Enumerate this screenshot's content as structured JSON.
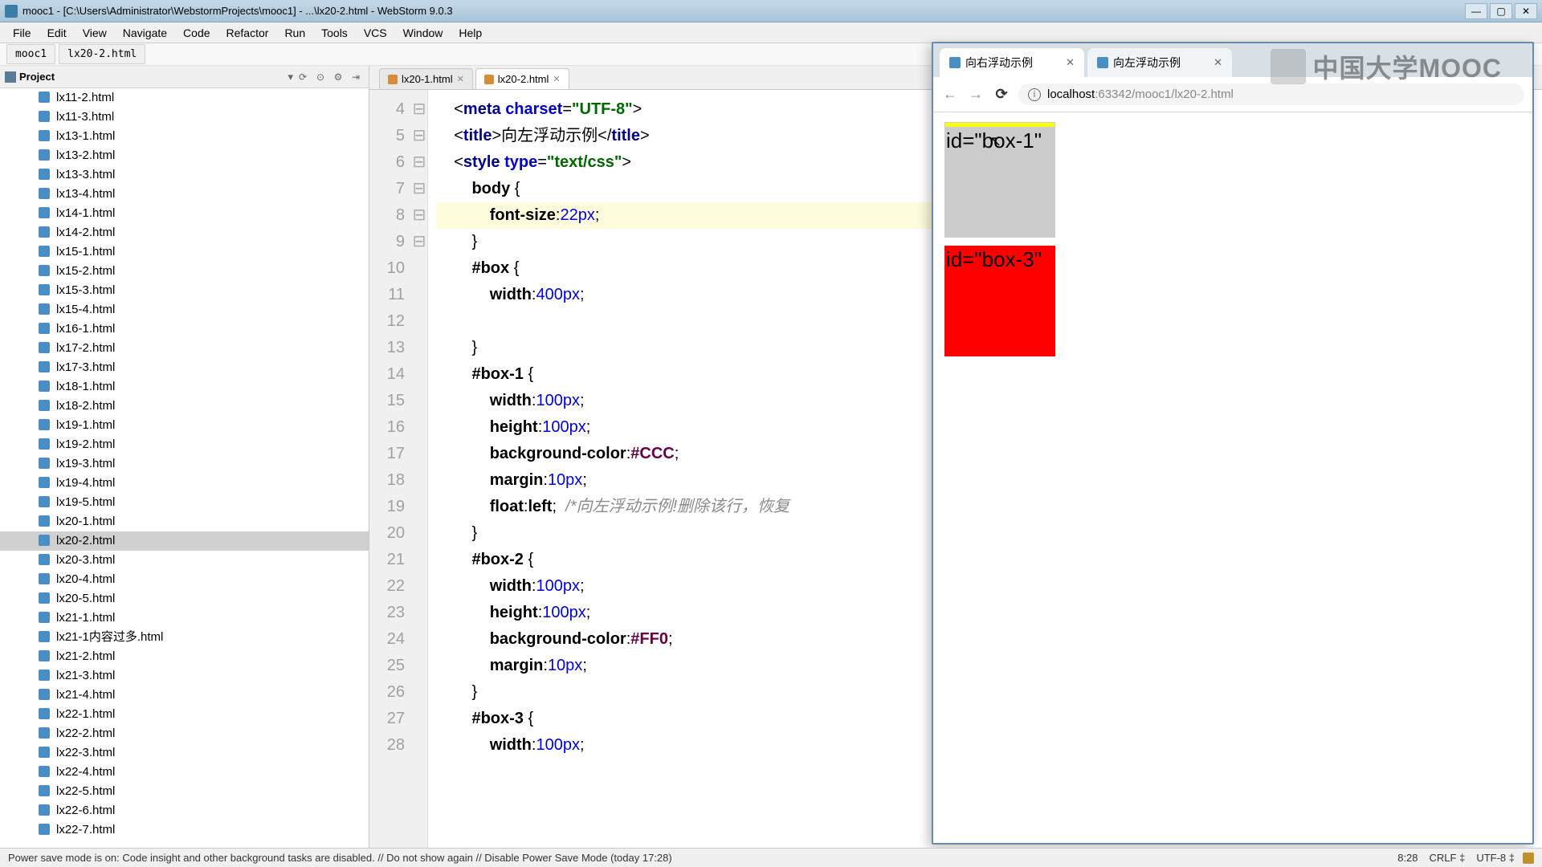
{
  "window": {
    "title": "mooc1 - [C:\\Users\\Administrator\\WebstormProjects\\mooc1] - ...\\lx20-2.html - WebStorm 9.0.3",
    "minimize": "—",
    "maximize": "▢",
    "close": "✕"
  },
  "menu": [
    "File",
    "Edit",
    "View",
    "Navigate",
    "Code",
    "Refactor",
    "Run",
    "Tools",
    "VCS",
    "Window",
    "Help"
  ],
  "breadcrumb": {
    "root": "mooc1",
    "file": "lx20-2.html"
  },
  "project": {
    "label": "Project",
    "collapse_icon": "▾",
    "tool_icons": {
      "sync": "⟳",
      "locate": "⊙",
      "gear": "⚙",
      "hide": "⇥"
    },
    "items": [
      "lx11-2.html",
      "lx11-3.html",
      "lx13-1.html",
      "lx13-2.html",
      "lx13-3.html",
      "lx13-4.html",
      "lx14-1.html",
      "lx14-2.html",
      "lx15-1.html",
      "lx15-2.html",
      "lx15-3.html",
      "lx15-4.html",
      "lx16-1.html",
      "lx17-2.html",
      "lx17-3.html",
      "lx18-1.html",
      "lx18-2.html",
      "lx19-1.html",
      "lx19-2.html",
      "lx19-3.html",
      "lx19-4.html",
      "lx19-5.html",
      "lx20-1.html",
      "lx20-2.html",
      "lx20-3.html",
      "lx20-4.html",
      "lx20-5.html",
      "lx21-1.html",
      "lx21-1内容过多.html",
      "lx21-2.html",
      "lx21-3.html",
      "lx21-4.html",
      "lx22-1.html",
      "lx22-2.html",
      "lx22-3.html",
      "lx22-4.html",
      "lx22-5.html",
      "lx22-6.html",
      "lx22-7.html"
    ],
    "selected_index": 23
  },
  "editor": {
    "tabs": [
      {
        "name": "lx20-1.html",
        "active": false
      },
      {
        "name": "lx20-2.html",
        "active": true
      }
    ],
    "first_line": 4,
    "lines": [
      {
        "no": 4,
        "fold": "",
        "html": "    <span class='punct'>&lt;</span><span class='kw'>meta</span> <span class='attr'>charset</span><span class='punct'>=</span><span class='str'>\"UTF-8\"</span><span class='punct'>&gt;</span>"
      },
      {
        "no": 5,
        "fold": "",
        "html": "    <span class='punct'>&lt;</span><span class='kw'>title</span><span class='punct'>&gt;</span>向左浮动示例<span class='punct'>&lt;/</span><span class='kw'>title</span><span class='punct'>&gt;</span>"
      },
      {
        "no": 6,
        "fold": "⊟",
        "html": "    <span class='punct'>&lt;</span><span class='kw'>style</span> <span class='attr'>type</span><span class='punct'>=</span><span class='str'>\"text/css\"</span><span class='punct'>&gt;</span>"
      },
      {
        "no": 7,
        "fold": "⊟",
        "html": "        <span class='sel'>body</span> <span class='punct'>{</span>"
      },
      {
        "no": 8,
        "fold": "",
        "hl": true,
        "html": "            <span class='prop'>font-size</span><span class='punct'>:</span><span class='num'>22px</span><span class='punct'>;</span>"
      },
      {
        "no": 9,
        "fold": "⊟",
        "html": "        <span class='punct'>}</span>"
      },
      {
        "no": 10,
        "fold": "",
        "html": "        <span class='sel'>#box</span> <span class='punct'>{</span>"
      },
      {
        "no": 11,
        "fold": "",
        "html": "            <span class='prop'>width</span><span class='punct'>:</span><span class='num'>400px</span><span class='punct'>;</span>"
      },
      {
        "no": 12,
        "fold": "",
        "html": ""
      },
      {
        "no": 13,
        "fold": "⊟",
        "html": "        <span class='punct'>}</span>"
      },
      {
        "no": 14,
        "fold": "",
        "html": "        <span class='sel'>#box-1</span> <span class='punct'>{</span>"
      },
      {
        "no": 15,
        "fold": "",
        "html": "            <span class='prop'>width</span><span class='punct'>:</span><span class='num'>100px</span><span class='punct'>;</span>"
      },
      {
        "no": 16,
        "fold": "",
        "html": "            <span class='prop'>height</span><span class='punct'>:</span><span class='num'>100px</span><span class='punct'>;</span>"
      },
      {
        "no": 17,
        "fold": "",
        "html": "            <span class='prop'>background-color</span><span class='punct'>:</span><span class='val-color'>#CCC</span><span class='punct'>;</span>"
      },
      {
        "no": 18,
        "fold": "",
        "html": "            <span class='prop'>margin</span><span class='punct'>:</span><span class='num'>10px</span><span class='punct'>;</span>"
      },
      {
        "no": 19,
        "fold": "",
        "html": "            <span class='prop'>float</span><span class='punct'>:</span><span class='sel'>left</span><span class='punct'>;</span>  <span class='cmt'>/*向左浮动示例!删除该行，恢复</span>"
      },
      {
        "no": 20,
        "fold": "⊟",
        "html": "        <span class='punct'>}</span>"
      },
      {
        "no": 21,
        "fold": "",
        "html": "        <span class='sel'>#box-2</span> <span class='punct'>{</span>"
      },
      {
        "no": 22,
        "fold": "",
        "html": "            <span class='prop'>width</span><span class='punct'>:</span><span class='num'>100px</span><span class='punct'>;</span>"
      },
      {
        "no": 23,
        "fold": "",
        "html": "            <span class='prop'>height</span><span class='punct'>:</span><span class='num'>100px</span><span class='punct'>;</span>"
      },
      {
        "no": 24,
        "fold": "",
        "html": "            <span class='prop'>background-color</span><span class='punct'>:</span><span class='val-color'>#FF0</span><span class='punct'>;</span>"
      },
      {
        "no": 25,
        "fold": "",
        "html": "            <span class='prop'>margin</span><span class='punct'>:</span><span class='num'>10px</span><span class='punct'>;</span>"
      },
      {
        "no": 26,
        "fold": "⊟",
        "html": "        <span class='punct'>}</span>"
      },
      {
        "no": 27,
        "fold": "",
        "html": "        <span class='sel'>#box-3</span> <span class='punct'>{</span>"
      },
      {
        "no": 28,
        "fold": "",
        "html": "            <span class='prop'>width</span><span class='punct'>:</span><span class='num'>100px</span><span class='punct'>;</span>"
      }
    ]
  },
  "browser": {
    "tabs": [
      {
        "title": "向右浮动示例",
        "active": true
      },
      {
        "title": "向左浮动示例",
        "active": false
      }
    ],
    "nav": {
      "back": "←",
      "forward": "→",
      "reload": "⟳",
      "info": "i"
    },
    "url_host": "localhost",
    "url_port_path": ":63342/mooc1/lx20-2.html",
    "preview": {
      "box1_text": "id=\"box-1\"",
      "box3_text": "id=\"box-3\""
    }
  },
  "status": {
    "left": "Power save mode is on: Code insight and other background tasks are disabled. // Do not show again // Disable Power Save Mode (today 17:28)",
    "pos": "8:28",
    "le": "CRLF ‡",
    "enc": "UTF-8 ‡"
  },
  "watermark": "中国大学MOOC"
}
